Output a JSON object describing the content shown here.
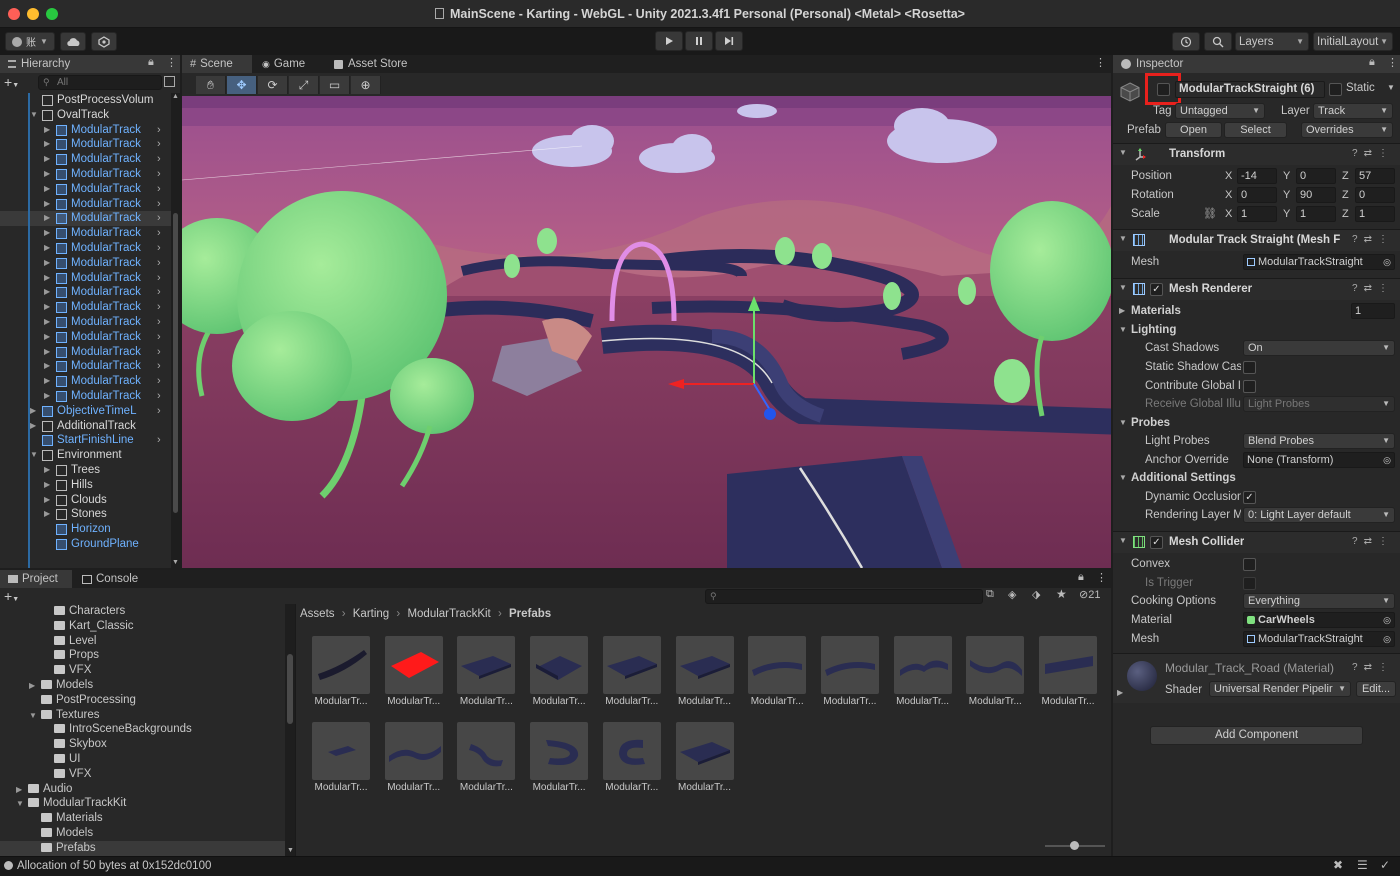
{
  "window": {
    "title": "MainScene - Karting - WebGL - Unity 2021.3.4f1 Personal (Personal) <Metal> <Rosetta>"
  },
  "toolbar": {
    "account_label": "账",
    "layers_label": "Layers",
    "layout_label": "InitialLayout"
  },
  "hierarchy": {
    "tab_label": "Hierarchy",
    "search_placeholder": "All",
    "items": [
      {
        "label": "PostProcessVolum",
        "indent": 1,
        "fold": "",
        "color": "white",
        "chevron": false,
        "selected": false
      },
      {
        "label": "OvalTrack",
        "indent": 1,
        "fold": "open",
        "color": "white",
        "chevron": false,
        "selected": false
      },
      {
        "label": "ModularTrack",
        "indent": 2,
        "fold": "closed",
        "color": "blue",
        "chevron": true,
        "selected": false
      },
      {
        "label": "ModularTrack",
        "indent": 2,
        "fold": "closed",
        "color": "blue",
        "chevron": true,
        "selected": false
      },
      {
        "label": "ModularTrack",
        "indent": 2,
        "fold": "closed",
        "color": "blue",
        "chevron": true,
        "selected": false
      },
      {
        "label": "ModularTrack",
        "indent": 2,
        "fold": "closed",
        "color": "blue",
        "chevron": true,
        "selected": false
      },
      {
        "label": "ModularTrack",
        "indent": 2,
        "fold": "closed",
        "color": "blue",
        "chevron": true,
        "selected": false
      },
      {
        "label": "ModularTrack",
        "indent": 2,
        "fold": "closed",
        "color": "blue",
        "chevron": true,
        "selected": false
      },
      {
        "label": "ModularTrack",
        "indent": 2,
        "fold": "closed",
        "color": "blue",
        "chevron": true,
        "selected": true
      },
      {
        "label": "ModularTrack",
        "indent": 2,
        "fold": "closed",
        "color": "blue",
        "chevron": true,
        "selected": false
      },
      {
        "label": "ModularTrack",
        "indent": 2,
        "fold": "closed",
        "color": "blue",
        "chevron": true,
        "selected": false
      },
      {
        "label": "ModularTrack",
        "indent": 2,
        "fold": "closed",
        "color": "blue",
        "chevron": true,
        "selected": false
      },
      {
        "label": "ModularTrack",
        "indent": 2,
        "fold": "closed",
        "color": "blue",
        "chevron": true,
        "selected": false
      },
      {
        "label": "ModularTrack",
        "indent": 2,
        "fold": "closed",
        "color": "blue",
        "chevron": true,
        "selected": false
      },
      {
        "label": "ModularTrack",
        "indent": 2,
        "fold": "closed",
        "color": "blue",
        "chevron": true,
        "selected": false
      },
      {
        "label": "ModularTrack",
        "indent": 2,
        "fold": "closed",
        "color": "blue",
        "chevron": true,
        "selected": false
      },
      {
        "label": "ModularTrack",
        "indent": 2,
        "fold": "closed",
        "color": "blue",
        "chevron": true,
        "selected": false
      },
      {
        "label": "ModularTrack",
        "indent": 2,
        "fold": "closed",
        "color": "blue",
        "chevron": true,
        "selected": false
      },
      {
        "label": "ModularTrack",
        "indent": 2,
        "fold": "closed",
        "color": "blue",
        "chevron": true,
        "selected": false
      },
      {
        "label": "ModularTrack",
        "indent": 2,
        "fold": "closed",
        "color": "blue",
        "chevron": true,
        "selected": false
      },
      {
        "label": "ModularTrack",
        "indent": 2,
        "fold": "closed",
        "color": "blue",
        "chevron": true,
        "selected": false
      },
      {
        "label": "ObjectiveTimeL",
        "indent": 1,
        "fold": "closed",
        "color": "blue",
        "chevron": true,
        "selected": false
      },
      {
        "label": "AdditionalTrack",
        "indent": 1,
        "fold": "closed",
        "color": "white",
        "chevron": false,
        "selected": false
      },
      {
        "label": "StartFinishLine",
        "indent": 1,
        "fold": "",
        "color": "blue",
        "chevron": true,
        "selected": false
      },
      {
        "label": "Environment",
        "indent": 1,
        "fold": "open",
        "color": "white",
        "chevron": false,
        "selected": false
      },
      {
        "label": "Trees",
        "indent": 2,
        "fold": "closed",
        "color": "white",
        "chevron": false,
        "selected": false
      },
      {
        "label": "Hills",
        "indent": 2,
        "fold": "closed",
        "color": "white",
        "chevron": false,
        "selected": false
      },
      {
        "label": "Clouds",
        "indent": 2,
        "fold": "closed",
        "color": "white",
        "chevron": false,
        "selected": false
      },
      {
        "label": "Stones",
        "indent": 2,
        "fold": "closed",
        "color": "white",
        "chevron": false,
        "selected": false
      },
      {
        "label": "Horizon",
        "indent": 2,
        "fold": "",
        "color": "blue",
        "chevron": false,
        "selected": false
      },
      {
        "label": "GroundPlane",
        "indent": 2,
        "fold": "",
        "color": "blue",
        "chevron": false,
        "selected": false
      }
    ]
  },
  "scene": {
    "tabs": [
      "Scene",
      "Game",
      "Asset Store"
    ]
  },
  "inspector": {
    "tab_label": "Inspector",
    "object_name": "ModularTrackStraight (6)",
    "static_label": "Static",
    "tag_label": "Tag",
    "tag_value": "Untagged",
    "layer_label": "Layer",
    "layer_value": "Track",
    "prefab_label": "Prefab",
    "prefab_open": "Open",
    "prefab_select": "Select",
    "prefab_overrides": "Overrides",
    "transform": {
      "title": "Transform",
      "position_label": "Position",
      "rotation_label": "Rotation",
      "scale_label": "Scale",
      "position": {
        "x": "-14",
        "y": "0",
        "z": "57"
      },
      "rotation": {
        "x": "0",
        "y": "90",
        "z": "0"
      },
      "scale": {
        "x": "1",
        "y": "1",
        "z": "1"
      }
    },
    "mesh_filter": {
      "title": "Modular Track Straight (Mesh F",
      "mesh_label": "Mesh",
      "mesh_value": "ModularTrackStraight"
    },
    "mesh_renderer": {
      "title": "Mesh Renderer",
      "materials_label": "Materials",
      "materials_count": "1",
      "lighting_label": "Lighting",
      "cast_shadows_label": "Cast Shadows",
      "cast_shadows_value": "On",
      "static_shadow_label": "Static Shadow Cas",
      "contribute_gi_label": "Contribute Global I",
      "receive_gi_label": "Receive Global Illu",
      "receive_gi_value": "Light Probes",
      "probes_label": "Probes",
      "light_probes_label": "Light Probes",
      "light_probes_value": "Blend Probes",
      "anchor_override_label": "Anchor Override",
      "anchor_override_value": "None (Transform)",
      "additional_label": "Additional Settings",
      "dynamic_occlusion_label": "Dynamic Occlusion",
      "rendering_layer_label": "Rendering Layer M",
      "rendering_layer_value": "0: Light Layer default"
    },
    "mesh_collider": {
      "title": "Mesh Collider",
      "convex_label": "Convex",
      "is_trigger_label": "Is Trigger",
      "cooking_label": "Cooking Options",
      "cooking_value": "Everything",
      "material_label": "Material",
      "material_value": "CarWheels",
      "mesh_label": "Mesh",
      "mesh_value": "ModularTrackStraight"
    },
    "material": {
      "name": "Modular_Track_Road (Material)",
      "shader_label": "Shader",
      "shader_value": "Universal Render Pipelir",
      "edit_label": "Edit..."
    },
    "add_component_label": "Add Component"
  },
  "project": {
    "tabs": [
      "Project",
      "Console"
    ],
    "hidden_count": "21",
    "breadcrumb": [
      "Assets",
      "Karting",
      "ModularTrackKit",
      "Prefabs"
    ],
    "tree": [
      {
        "label": "Characters",
        "indent": 3,
        "fold": ""
      },
      {
        "label": "Kart_Classic",
        "indent": 3,
        "fold": ""
      },
      {
        "label": "Level",
        "indent": 3,
        "fold": ""
      },
      {
        "label": "Props",
        "indent": 3,
        "fold": ""
      },
      {
        "label": "VFX",
        "indent": 3,
        "fold": ""
      },
      {
        "label": "Models",
        "indent": 2,
        "fold": "closed"
      },
      {
        "label": "PostProcessing",
        "indent": 2,
        "fold": ""
      },
      {
        "label": "Textures",
        "indent": 2,
        "fold": "open"
      },
      {
        "label": "IntroSceneBackgrounds",
        "indent": 3,
        "fold": ""
      },
      {
        "label": "Skybox",
        "indent": 3,
        "fold": ""
      },
      {
        "label": "UI",
        "indent": 3,
        "fold": ""
      },
      {
        "label": "VFX",
        "indent": 3,
        "fold": ""
      },
      {
        "label": "Audio",
        "indent": 1,
        "fold": "closed"
      },
      {
        "label": "ModularTrackKit",
        "indent": 1,
        "fold": "open"
      },
      {
        "label": "Materials",
        "indent": 2,
        "fold": ""
      },
      {
        "label": "Models",
        "indent": 2,
        "fold": ""
      },
      {
        "label": "Prefabs",
        "indent": 2,
        "fold": "",
        "selected": true
      }
    ],
    "assets": [
      {
        "label": "ModularTr...",
        "kind": "curve-left"
      },
      {
        "label": "ModularTr...",
        "kind": "red"
      },
      {
        "label": "ModularTr...",
        "kind": "straight"
      },
      {
        "label": "ModularTr...",
        "kind": "ramp"
      },
      {
        "label": "ModularTr...",
        "kind": "straight"
      },
      {
        "label": "ModularTr...",
        "kind": "straight"
      },
      {
        "label": "ModularTr...",
        "kind": "curve"
      },
      {
        "label": "ModularTr...",
        "kind": "curve"
      },
      {
        "label": "ModularTr...",
        "kind": "bump"
      },
      {
        "label": "ModularTr...",
        "kind": "wave"
      },
      {
        "label": "ModularTr...",
        "kind": "curve-right"
      },
      {
        "label": "ModularTr...",
        "kind": "small"
      },
      {
        "label": "ModularTr...",
        "kind": "s-curve"
      },
      {
        "label": "ModularTr...",
        "kind": "hill"
      },
      {
        "label": "ModularTr...",
        "kind": "u-turn"
      },
      {
        "label": "ModularTr...",
        "kind": "loop"
      },
      {
        "label": "ModularTr...",
        "kind": "straight"
      }
    ]
  },
  "status": {
    "message": "Allocation of 50 bytes at 0x152dc0100"
  },
  "colors": {
    "highlight_box": "#e8211d",
    "accent_blue": "#6fb2ff",
    "selection": "#2c5d87"
  }
}
